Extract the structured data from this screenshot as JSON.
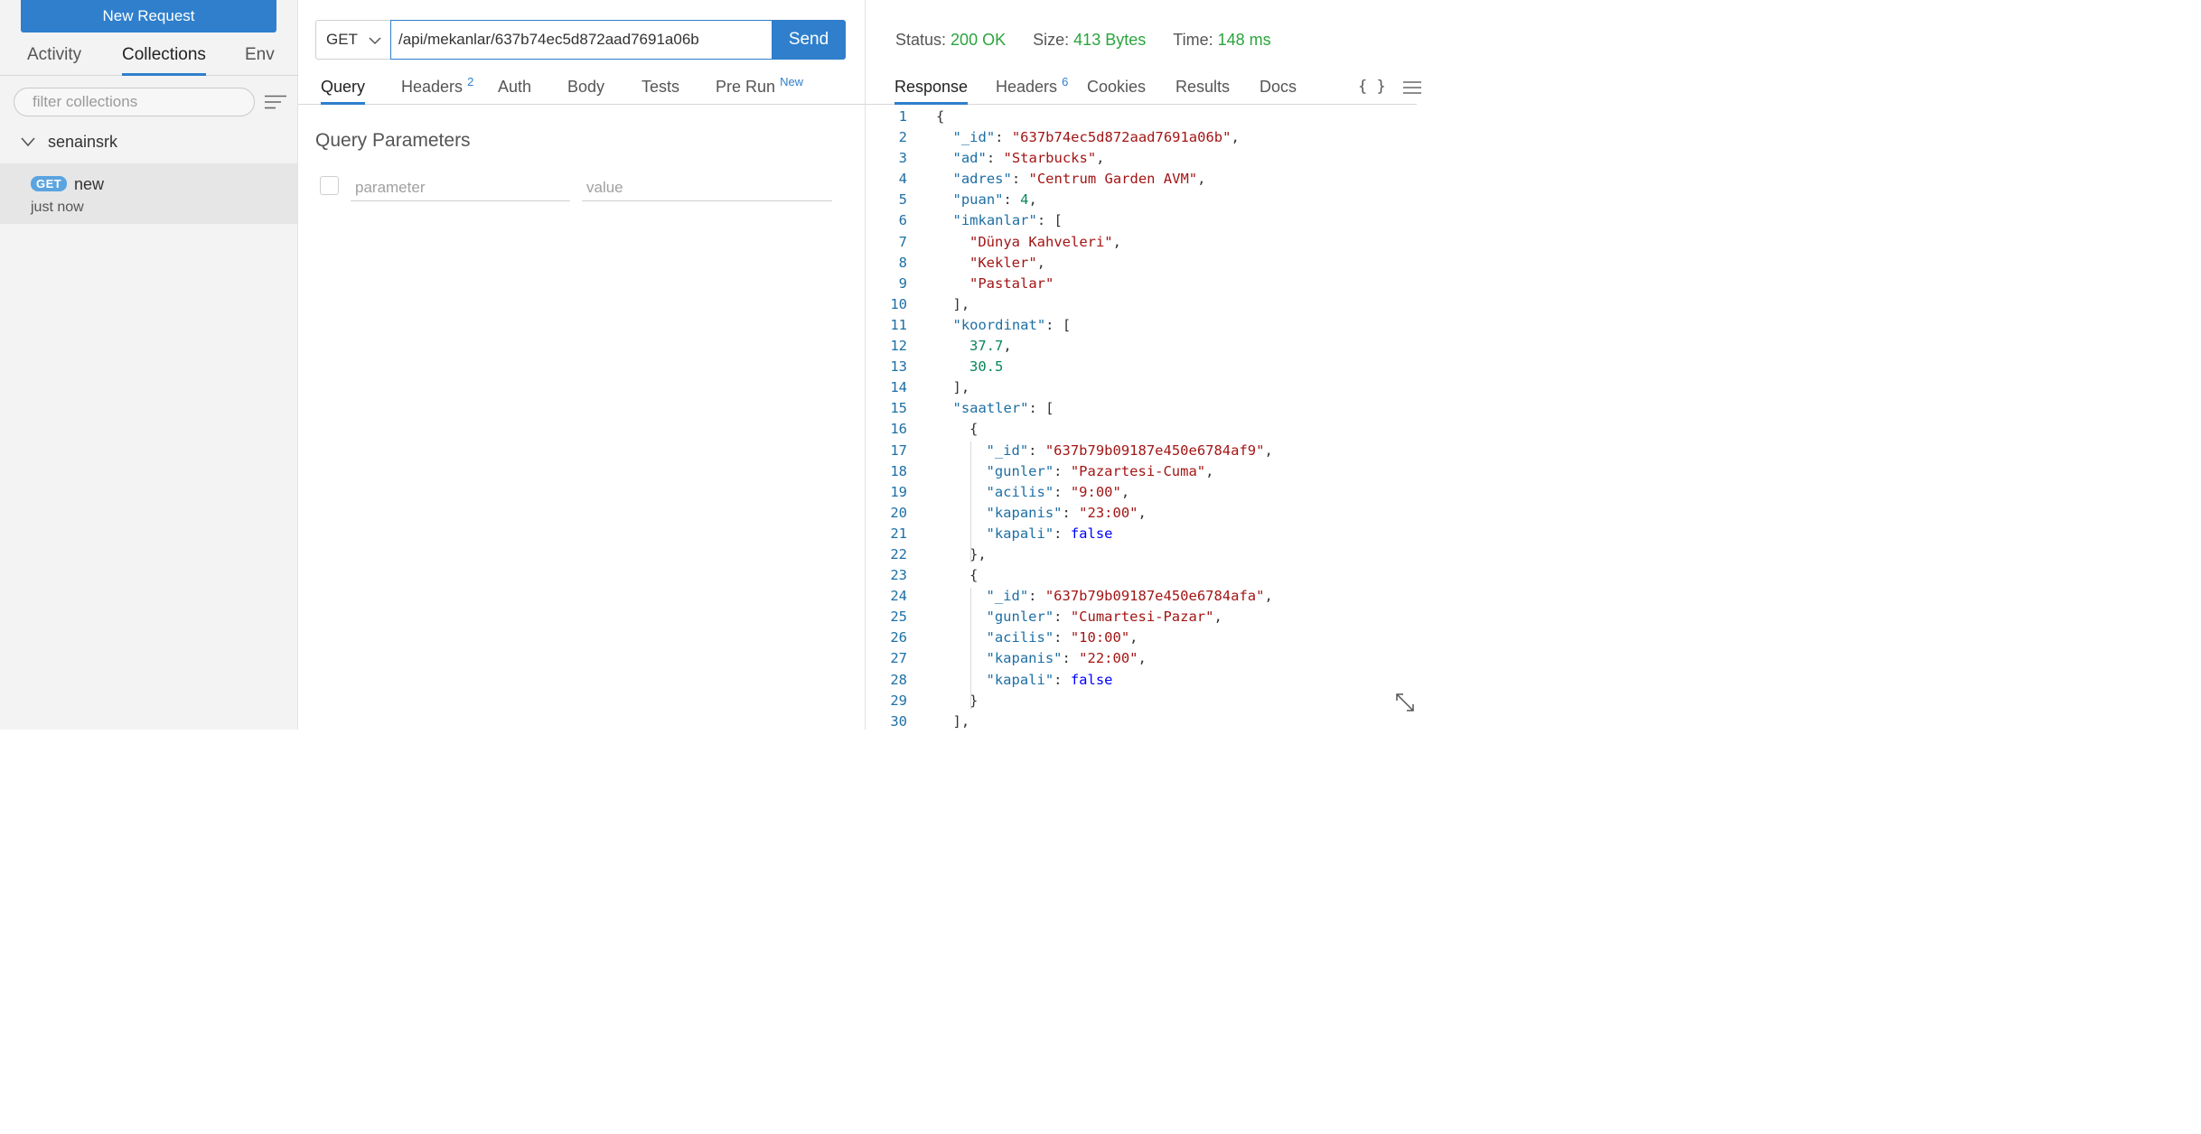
{
  "sidebar": {
    "new_request": "New Request",
    "tabs": [
      "Activity",
      "Collections",
      "Env"
    ],
    "active_tab": "Collections",
    "filter_placeholder": "filter collections",
    "collection_name": "senainsrk",
    "request": {
      "method": "GET",
      "name": "new",
      "time": "just now"
    }
  },
  "request": {
    "method": "GET",
    "url": "/api/mekanlar/637b74ec5d872aad7691a06b",
    "send_label": "Send",
    "tabs": [
      {
        "label": "Query",
        "sup": ""
      },
      {
        "label": "Headers",
        "sup": "2"
      },
      {
        "label": "Auth",
        "sup": ""
      },
      {
        "label": "Body",
        "sup": ""
      },
      {
        "label": "Tests",
        "sup": ""
      },
      {
        "label": "Pre Run",
        "sup": "New"
      }
    ],
    "active_tab": "Query",
    "section_title": "Query Parameters",
    "param_placeholder": "parameter",
    "value_placeholder": "value"
  },
  "response": {
    "status_label": "Status:",
    "status_value": "200 OK",
    "size_label": "Size:",
    "size_value": "413 Bytes",
    "time_label": "Time:",
    "time_value": "148 ms",
    "tabs": [
      {
        "label": "Response",
        "sup": ""
      },
      {
        "label": "Headers",
        "sup": "6"
      },
      {
        "label": "Cookies",
        "sup": ""
      },
      {
        "label": "Results",
        "sup": ""
      },
      {
        "label": "Docs",
        "sup": ""
      }
    ],
    "active_tab": "Response",
    "format_icon": "{ }",
    "colors": {
      "accent": "#2f7fcc",
      "status_ok": "#2aa43d",
      "json_key": "#1d6fa5",
      "json_string": "#a31515",
      "json_number": "#098658",
      "json_bool": "#0000ff"
    },
    "lines": [
      {
        "indent": 0,
        "tokens": [
          [
            "p",
            "{"
          ]
        ]
      },
      {
        "indent": 1,
        "tokens": [
          [
            "k",
            "\"_id\""
          ],
          [
            "p",
            ": "
          ],
          [
            "s",
            "\"637b74ec5d872aad7691a06b\""
          ],
          [
            "p",
            ","
          ]
        ]
      },
      {
        "indent": 1,
        "tokens": [
          [
            "k",
            "\"ad\""
          ],
          [
            "p",
            ": "
          ],
          [
            "s",
            "\"Starbucks\""
          ],
          [
            "p",
            ","
          ]
        ]
      },
      {
        "indent": 1,
        "tokens": [
          [
            "k",
            "\"adres\""
          ],
          [
            "p",
            ": "
          ],
          [
            "s",
            "\"Centrum Garden AVM\""
          ],
          [
            "p",
            ","
          ]
        ]
      },
      {
        "indent": 1,
        "tokens": [
          [
            "k",
            "\"puan\""
          ],
          [
            "p",
            ": "
          ],
          [
            "n",
            "4"
          ],
          [
            "p",
            ","
          ]
        ]
      },
      {
        "indent": 1,
        "tokens": [
          [
            "k",
            "\"imkanlar\""
          ],
          [
            "p",
            ": ["
          ]
        ]
      },
      {
        "indent": 2,
        "tokens": [
          [
            "s",
            "\"Dünya Kahveleri\""
          ],
          [
            "p",
            ","
          ]
        ]
      },
      {
        "indent": 2,
        "tokens": [
          [
            "s",
            "\"Kekler\""
          ],
          [
            "p",
            ","
          ]
        ]
      },
      {
        "indent": 2,
        "tokens": [
          [
            "s",
            "\"Pastalar\""
          ]
        ]
      },
      {
        "indent": 1,
        "tokens": [
          [
            "p",
            "],"
          ]
        ]
      },
      {
        "indent": 1,
        "tokens": [
          [
            "k",
            "\"koordinat\""
          ],
          [
            "p",
            ": ["
          ]
        ]
      },
      {
        "indent": 2,
        "tokens": [
          [
            "n",
            "37.7"
          ],
          [
            "p",
            ","
          ]
        ]
      },
      {
        "indent": 2,
        "tokens": [
          [
            "n",
            "30.5"
          ]
        ]
      },
      {
        "indent": 1,
        "tokens": [
          [
            "p",
            "],"
          ]
        ]
      },
      {
        "indent": 1,
        "tokens": [
          [
            "k",
            "\"saatler\""
          ],
          [
            "p",
            ": ["
          ]
        ]
      },
      {
        "indent": 2,
        "tokens": [
          [
            "p",
            "{"
          ]
        ]
      },
      {
        "indent": 3,
        "tokens": [
          [
            "k",
            "\"_id\""
          ],
          [
            "p",
            ": "
          ],
          [
            "s",
            "\"637b79b09187e450e6784af9\""
          ],
          [
            "p",
            ","
          ]
        ]
      },
      {
        "indent": 3,
        "tokens": [
          [
            "k",
            "\"gunler\""
          ],
          [
            "p",
            ": "
          ],
          [
            "s",
            "\"Pazartesi-Cuma\""
          ],
          [
            "p",
            ","
          ]
        ]
      },
      {
        "indent": 3,
        "tokens": [
          [
            "k",
            "\"acilis\""
          ],
          [
            "p",
            ": "
          ],
          [
            "s",
            "\"9:00\""
          ],
          [
            "p",
            ","
          ]
        ]
      },
      {
        "indent": 3,
        "tokens": [
          [
            "k",
            "\"kapanis\""
          ],
          [
            "p",
            ": "
          ],
          [
            "s",
            "\"23:00\""
          ],
          [
            "p",
            ","
          ]
        ]
      },
      {
        "indent": 3,
        "tokens": [
          [
            "k",
            "\"kapali\""
          ],
          [
            "p",
            ": "
          ],
          [
            "b",
            "false"
          ]
        ]
      },
      {
        "indent": 2,
        "tokens": [
          [
            "p",
            "},"
          ]
        ]
      },
      {
        "indent": 2,
        "tokens": [
          [
            "p",
            "{"
          ]
        ]
      },
      {
        "indent": 3,
        "tokens": [
          [
            "k",
            "\"_id\""
          ],
          [
            "p",
            ": "
          ],
          [
            "s",
            "\"637b79b09187e450e6784afa\""
          ],
          [
            "p",
            ","
          ]
        ]
      },
      {
        "indent": 3,
        "tokens": [
          [
            "k",
            "\"gunler\""
          ],
          [
            "p",
            ": "
          ],
          [
            "s",
            "\"Cumartesi-Pazar\""
          ],
          [
            "p",
            ","
          ]
        ]
      },
      {
        "indent": 3,
        "tokens": [
          [
            "k",
            "\"acilis\""
          ],
          [
            "p",
            ": "
          ],
          [
            "s",
            "\"10:00\""
          ],
          [
            "p",
            ","
          ]
        ]
      },
      {
        "indent": 3,
        "tokens": [
          [
            "k",
            "\"kapanis\""
          ],
          [
            "p",
            ": "
          ],
          [
            "s",
            "\"22:00\""
          ],
          [
            "p",
            ","
          ]
        ]
      },
      {
        "indent": 3,
        "tokens": [
          [
            "k",
            "\"kapali\""
          ],
          [
            "p",
            ": "
          ],
          [
            "b",
            "false"
          ]
        ]
      },
      {
        "indent": 2,
        "tokens": [
          [
            "p",
            "}"
          ]
        ]
      },
      {
        "indent": 1,
        "tokens": [
          [
            "p",
            "],"
          ]
        ]
      }
    ]
  }
}
